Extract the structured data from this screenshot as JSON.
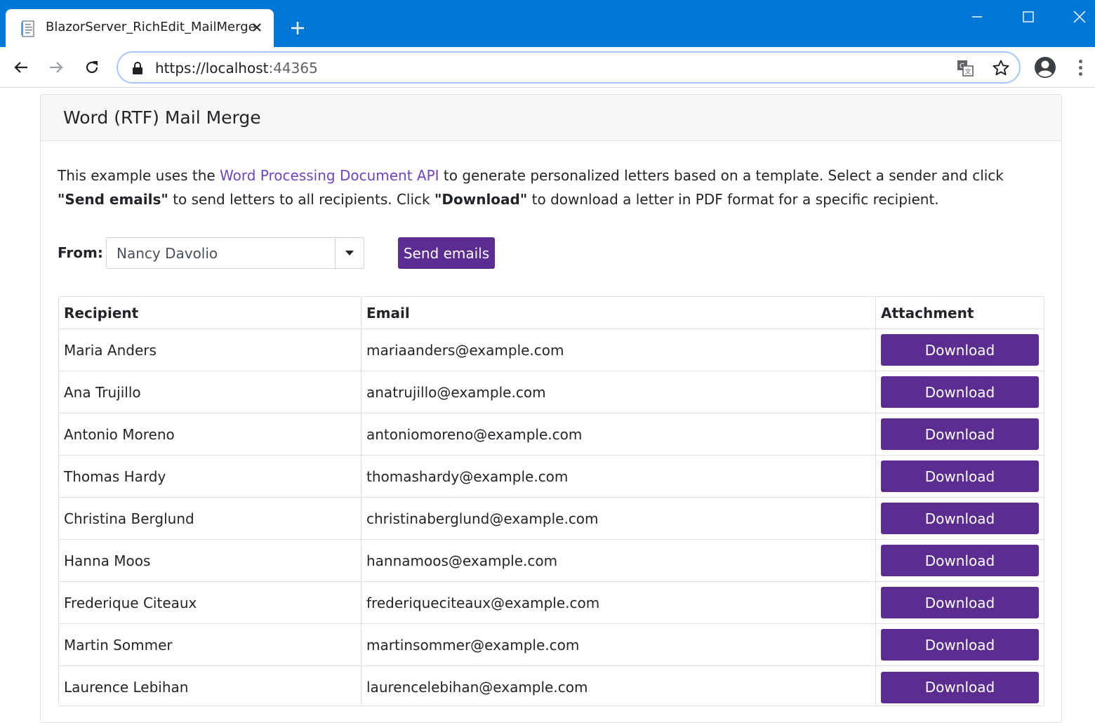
{
  "browser": {
    "tab_title": "BlazorServer_RichEdit_MailMerge",
    "url_host": "https://localhost",
    "url_port": ":44365",
    "icons": [
      "page-favicon-icon",
      "close-icon",
      "plus-icon",
      "minimize-icon",
      "maximize-icon",
      "close-window-icon",
      "back-arrow-icon",
      "forward-arrow-icon",
      "reload-icon",
      "lock-icon",
      "translate-icon",
      "star-icon",
      "profile-avatar-icon",
      "more-vert-icon"
    ]
  },
  "page": {
    "title": "Word (RTF) Mail Merge",
    "intro": {
      "part1": "This example uses the ",
      "link": "Word Processing Document API",
      "part2": " to generate personalized letters based on a template. Select a sender and click ",
      "bold1": "\"Send emails\"",
      "part3": " to send letters to all recipients. Click ",
      "bold2": "\"Download\"",
      "part4": " to download a letter in PDF format for a specific recipient."
    },
    "from_label": "From:",
    "from_selected": "Nancy Davolio",
    "send_button": "Send emails",
    "accent_color": "#5c2d91",
    "link_color": "#6f42c1"
  },
  "grid": {
    "columns": [
      "Recipient",
      "Email",
      "Attachment"
    ],
    "download_label": "Download",
    "rows": [
      {
        "name": "Maria Anders",
        "email": "mariaanders@example.com"
      },
      {
        "name": "Ana Trujillo",
        "email": "anatrujillo@example.com"
      },
      {
        "name": "Antonio Moreno",
        "email": "antoniomoreno@example.com"
      },
      {
        "name": "Thomas Hardy",
        "email": "thomashardy@example.com"
      },
      {
        "name": "Christina Berglund",
        "email": "christinaberglund@example.com"
      },
      {
        "name": "Hanna Moos",
        "email": "hannamoos@example.com"
      },
      {
        "name": "Frederique Citeaux",
        "email": "frederiqueciteaux@example.com"
      },
      {
        "name": "Martin Sommer",
        "email": "martinsommer@example.com"
      },
      {
        "name": "Laurence Lebihan",
        "email": "laurencelebihan@example.com"
      }
    ]
  }
}
